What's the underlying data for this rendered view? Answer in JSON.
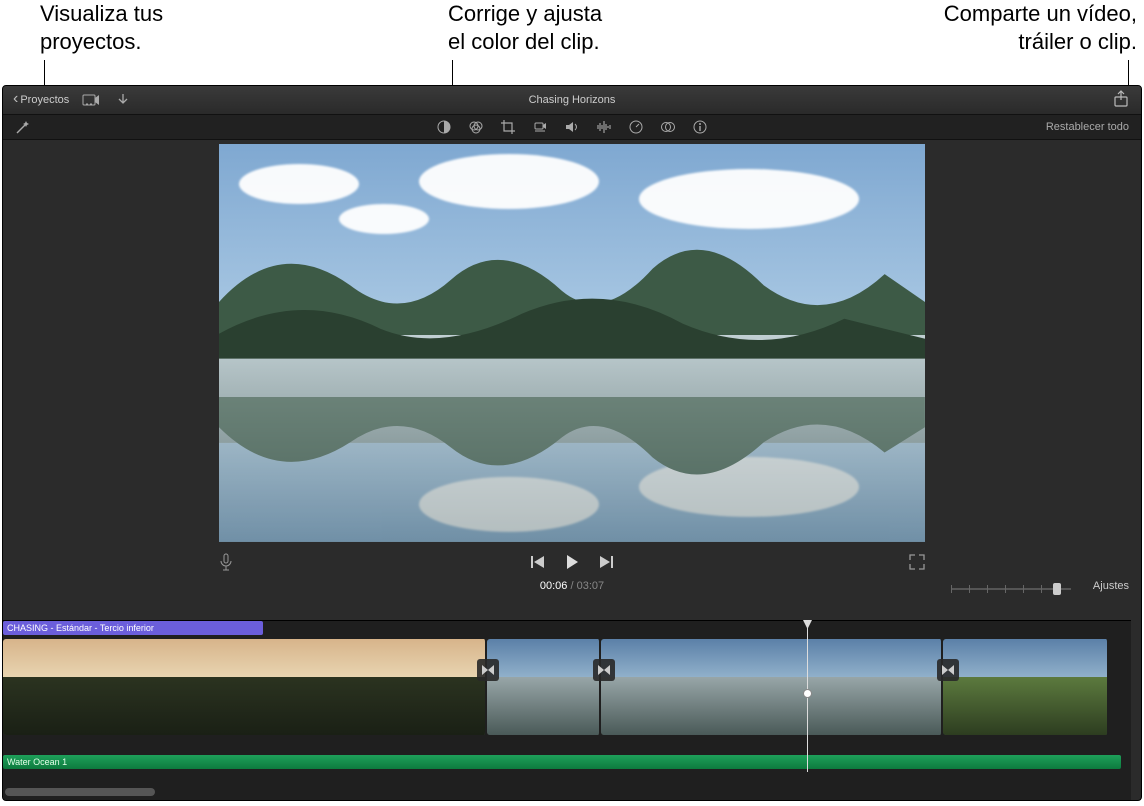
{
  "callouts": {
    "left_l1": "Visualiza tus",
    "left_l2": "proyectos.",
    "mid_l1": "Corrige y ajusta",
    "mid_l2": "el color del clip.",
    "right_l1": "Comparte un vídeo,",
    "right_l2": "tráiler o clip."
  },
  "titlebar": {
    "back_label": "Proyectos",
    "project_title": "Chasing Horizons"
  },
  "inspector": {
    "reset_label": "Restablecer todo"
  },
  "playback": {
    "current_time": "00:06",
    "separator": " / ",
    "duration": "03:07"
  },
  "timeline": {
    "settings_label": "Ajustes",
    "title_clip_label": "CHASING - Estándar - Tercio inferior",
    "audio_clip_label": "Water Ocean 1"
  },
  "icons": {
    "media_import": "media-import-icon",
    "import_download": "import-download-icon",
    "share": "share-icon",
    "magic_wand": "magic-wand-icon",
    "color_balance": "color-balance-icon",
    "color_correction": "color-correction-icon",
    "crop": "crop-icon",
    "stabilize": "stabilize-icon",
    "volume": "volume-icon",
    "noise": "noise-reduction-icon",
    "speed": "speed-icon",
    "filter": "clip-filter-icon",
    "info": "info-icon",
    "mic": "microphone-icon",
    "prev": "previous-icon",
    "play": "play-icon",
    "next": "next-icon",
    "fullscreen": "fullscreen-icon",
    "transition": "transition-icon"
  }
}
